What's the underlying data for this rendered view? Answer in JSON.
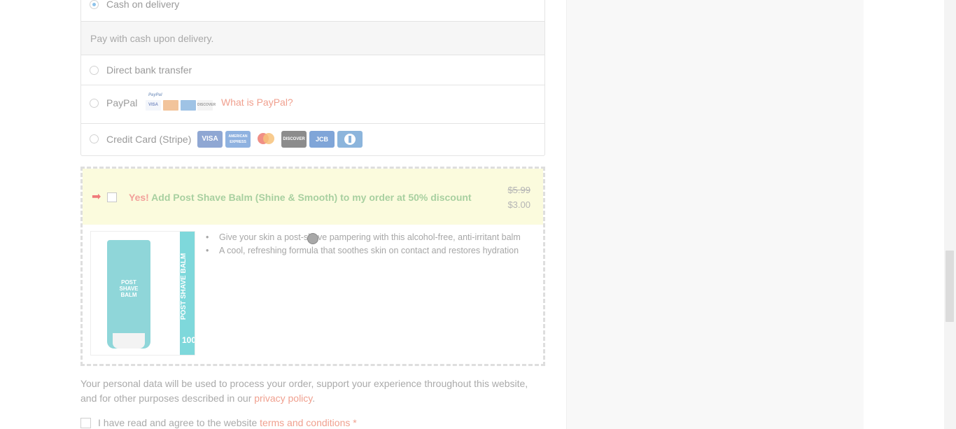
{
  "payment_methods": {
    "cod": {
      "label": "Cash on delivery",
      "selected": true,
      "description": "Pay with cash upon delivery."
    },
    "bank": {
      "label": "Direct bank transfer",
      "selected": false
    },
    "paypal": {
      "label": "PayPal",
      "logo_text": "PayPal",
      "cards": [
        "VISA",
        "MC",
        "AMEX",
        "DISCOVER"
      ],
      "what_is_link": "What is PayPal?",
      "selected": false
    },
    "stripe": {
      "label": "Credit Card (Stripe)",
      "cards": [
        "VISA",
        "AMERICAN EXPRESS",
        "mastercard",
        "DISCOVER",
        "JCB",
        "Diners"
      ],
      "selected": false
    }
  },
  "upsell": {
    "arrow_icon": "arrow-right-icon",
    "title_yes": "Yes!",
    "title_rest": " Add Post Shave Balm (Shine & Smooth) to my order at 50% discount",
    "price_old": "$5.99",
    "price_new": "$3.00",
    "product_tube_text": "POST\nSHAVE\nBALM",
    "product_box_text": "POST SHAVE BALM",
    "product_box_number": "100",
    "bullets": [
      "Give your skin a post-shave pampering with this alcohol-free, anti-irritant balm",
      "A cool, refreshing formula that soothes skin on contact and restores hydration"
    ]
  },
  "privacy": {
    "text_before": "Your personal data will be used to process your order, support your experience throughout this website, and for other purposes described in our ",
    "link": "privacy policy",
    "text_after": "."
  },
  "terms": {
    "text_before": "I have read and agree to the website ",
    "link": "terms and conditions",
    "required_mark": "*"
  },
  "colors": {
    "accent_link": "#f0a08f",
    "offer_bg": "#fbfbdd",
    "offer_title_green": "#a8d0a0",
    "offer_title_red": "#f2a09a"
  }
}
